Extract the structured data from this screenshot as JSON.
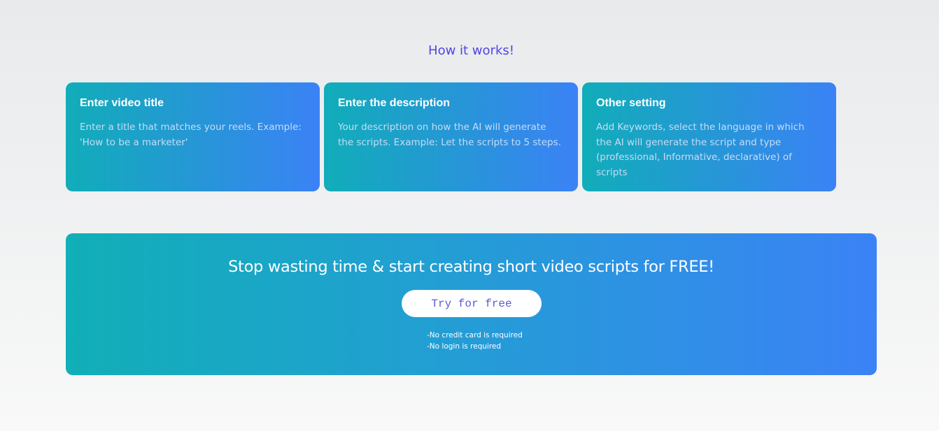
{
  "how_it_works": {
    "title": "How it works!",
    "cards": [
      {
        "title": "Enter video title",
        "text": "Enter a title that matches your reels. Example: 'How to be a marketer'"
      },
      {
        "title": "Enter the description",
        "text": "Your description on how the AI will generate the scripts. Example: Let the scripts to 5 steps."
      },
      {
        "title": "Other setting",
        "text": "Add Keywords, select the language in which the AI will generate the script and type (professional, Informative, declarative) of scripts"
      }
    ]
  },
  "cta": {
    "heading": "Stop wasting time & start creating short video scripts for FREE!",
    "button_label": "Try for free",
    "notes": [
      "-No credit card is required",
      "-No login is required"
    ]
  },
  "colors": {
    "accent": "#4f46e5",
    "gradient_start": "#11adb9",
    "gradient_end": "#3b82f6",
    "button_text": "#5b5bd6"
  }
}
